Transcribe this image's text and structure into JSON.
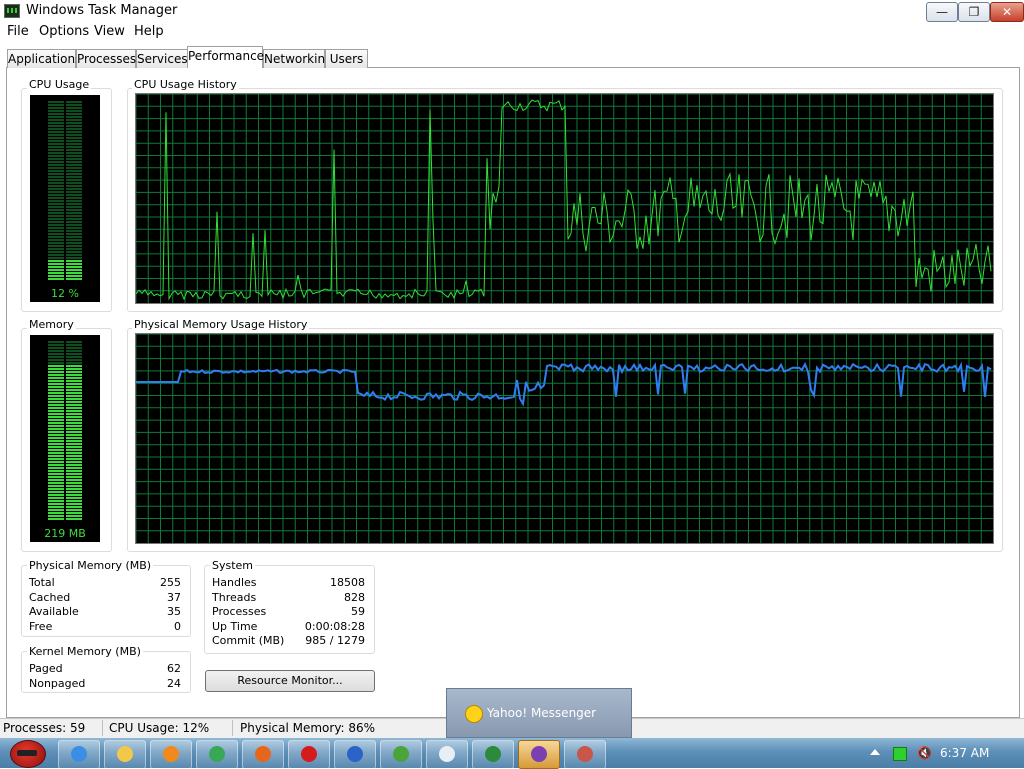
{
  "window": {
    "title": "Windows Task Manager",
    "min_glyph": "—",
    "max_glyph": "❐",
    "close_glyph": "✕"
  },
  "menu": [
    "File",
    "Options",
    "View",
    "Help"
  ],
  "tabs": [
    {
      "label": "Applications",
      "active": false
    },
    {
      "label": "Processes",
      "active": false
    },
    {
      "label": "Services",
      "active": false
    },
    {
      "label": "Performance",
      "active": true
    },
    {
      "label": "Networking",
      "active": false
    },
    {
      "label": "Users",
      "active": false
    }
  ],
  "cpu": {
    "title": "CPU Usage",
    "value_text": "12 %",
    "fraction": 0.12,
    "color": "#3ddc3d"
  },
  "cpu_history": {
    "title": "CPU Usage History",
    "line_color": "#33e033",
    "grid_color": "#0e7a3a"
  },
  "memory": {
    "title": "Memory",
    "value_text": "219 MB",
    "fraction": 0.86,
    "color": "#3ddc3d"
  },
  "memory_history": {
    "title": "Physical Memory Usage History",
    "line_color": "#2f7ff0",
    "grid_color": "#0e7a3a"
  },
  "physical_memory": {
    "title": "Physical Memory (MB)",
    "rows": [
      {
        "label": "Total",
        "value": "255"
      },
      {
        "label": "Cached",
        "value": "37"
      },
      {
        "label": "Available",
        "value": "35"
      },
      {
        "label": "Free",
        "value": "0"
      }
    ]
  },
  "kernel_memory": {
    "title": "Kernel Memory (MB)",
    "rows": [
      {
        "label": "Paged",
        "value": "62"
      },
      {
        "label": "Nonpaged",
        "value": "24"
      }
    ]
  },
  "system": {
    "title": "System",
    "rows": [
      {
        "label": "Handles",
        "value": "18508"
      },
      {
        "label": "Threads",
        "value": "828"
      },
      {
        "label": "Processes",
        "value": "59"
      },
      {
        "label": "Up Time",
        "value": "0:00:08:28"
      },
      {
        "label": "Commit (MB)",
        "value": "985 / 1279"
      }
    ]
  },
  "resource_monitor_label": "Resource Monitor...",
  "status": {
    "processes": "Processes: 59",
    "cpu": "CPU Usage: 12%",
    "memory": "Physical Memory: 86%"
  },
  "popup": {
    "label": "Yahoo! Messenger"
  },
  "taskbar": {
    "clock": "6:37 AM",
    "icons": [
      {
        "name": "internet-explorer-icon",
        "color": "#3a8ee6"
      },
      {
        "name": "folder-icon",
        "color": "#f2c84b"
      },
      {
        "name": "media-player-icon",
        "color": "#f08a1c"
      },
      {
        "name": "chrome-icon",
        "color": "#3aa757"
      },
      {
        "name": "firefox-icon",
        "color": "#e8661c"
      },
      {
        "name": "opera-icon",
        "color": "#d41c1c"
      },
      {
        "name": "office-icon",
        "color": "#2a64c8"
      },
      {
        "name": "utorrent-icon",
        "color": "#4aa43a"
      },
      {
        "name": "chat-icon",
        "color": "#e8eef5"
      },
      {
        "name": "task-manager-icon",
        "color": "#2c8a3a"
      },
      {
        "name": "yahoo-messenger-icon",
        "color": "#7b3fb2"
      },
      {
        "name": "tools-icon",
        "color": "#c8564a"
      }
    ]
  }
}
